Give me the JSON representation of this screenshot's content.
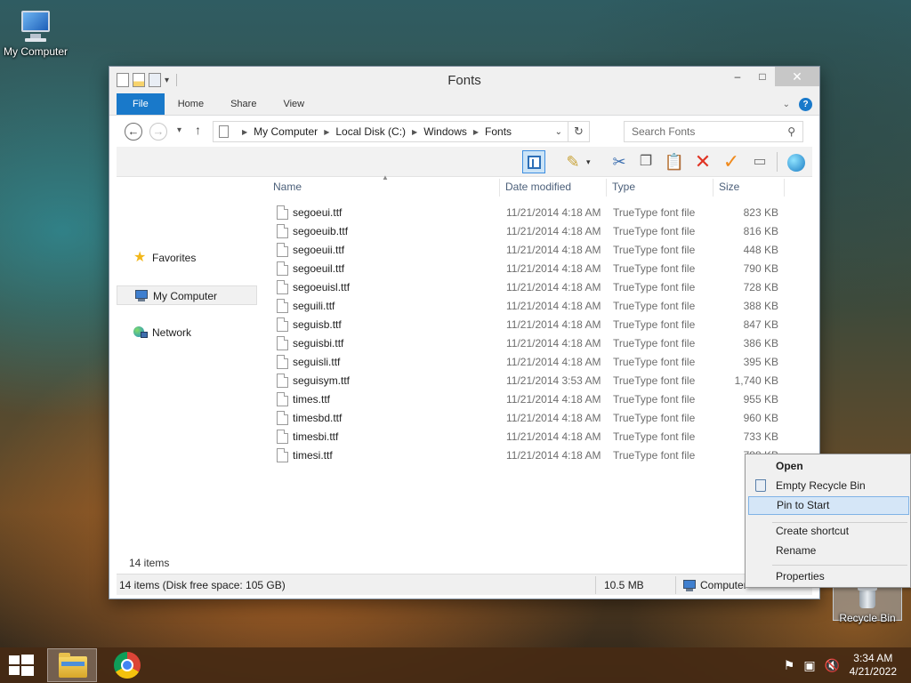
{
  "desktop": {
    "my_computer_label": "My Computer",
    "recycle_bin_label": "Recycle Bin"
  },
  "window": {
    "title": "Fonts",
    "buttons": {
      "minimize": "–",
      "maximize": "□",
      "close": "✕"
    }
  },
  "ribbon": {
    "tabs": [
      "File",
      "Home",
      "Share",
      "View"
    ],
    "help": "?"
  },
  "address": {
    "crumbs": [
      "My Computer",
      "Local Disk (C:)",
      "Windows",
      "Fonts"
    ],
    "search_placeholder": "Search Fonts"
  },
  "nav_pane": {
    "items": [
      "Favorites",
      "My Computer",
      "Network"
    ]
  },
  "columns": {
    "name": "Name",
    "date": "Date modified",
    "type": "Type",
    "size": "Size"
  },
  "files": [
    {
      "name": "segoeui.ttf",
      "date": "11/21/2014 4:18 AM",
      "type": "TrueType font file",
      "size": "823 KB"
    },
    {
      "name": "segoeuib.ttf",
      "date": "11/21/2014 4:18 AM",
      "type": "TrueType font file",
      "size": "816 KB"
    },
    {
      "name": "segoeuii.ttf",
      "date": "11/21/2014 4:18 AM",
      "type": "TrueType font file",
      "size": "448 KB"
    },
    {
      "name": "segoeuil.ttf",
      "date": "11/21/2014 4:18 AM",
      "type": "TrueType font file",
      "size": "790 KB"
    },
    {
      "name": "segoeuisl.ttf",
      "date": "11/21/2014 4:18 AM",
      "type": "TrueType font file",
      "size": "728 KB"
    },
    {
      "name": "seguili.ttf",
      "date": "11/21/2014 4:18 AM",
      "type": "TrueType font file",
      "size": "388 KB"
    },
    {
      "name": "seguisb.ttf",
      "date": "11/21/2014 4:18 AM",
      "type": "TrueType font file",
      "size": "847 KB"
    },
    {
      "name": "seguisbi.ttf",
      "date": "11/21/2014 4:18 AM",
      "type": "TrueType font file",
      "size": "386 KB"
    },
    {
      "name": "seguisli.ttf",
      "date": "11/21/2014 4:18 AM",
      "type": "TrueType font file",
      "size": "395 KB"
    },
    {
      "name": "seguisym.ttf",
      "date": "11/21/2014 3:53 AM",
      "type": "TrueType font file",
      "size": "1,740 KB"
    },
    {
      "name": "times.ttf",
      "date": "11/21/2014 4:18 AM",
      "type": "TrueType font file",
      "size": "955 KB"
    },
    {
      "name": "timesbd.ttf",
      "date": "11/21/2014 4:18 AM",
      "type": "TrueType font file",
      "size": "960 KB"
    },
    {
      "name": "timesbi.ttf",
      "date": "11/21/2014 4:18 AM",
      "type": "TrueType font file",
      "size": "733 KB"
    },
    {
      "name": "timesi.ttf",
      "date": "11/21/2014 4:18 AM",
      "type": "TrueType font file",
      "size": "788 KB"
    }
  ],
  "item_count": "14 items",
  "status": {
    "left": "14 items (Disk free space: 105 GB)",
    "size": "10.5 MB",
    "location": "Computer"
  },
  "context_menu": {
    "items": [
      "Open",
      "Empty Recycle Bin",
      "Pin to Start",
      "Create shortcut",
      "Rename",
      "Properties"
    ]
  },
  "taskbar": {
    "time": "3:34 AM",
    "date": "4/21/2022"
  },
  "colors": {
    "accent": "#1979ca",
    "menu_highlight": "#d5e6f7"
  }
}
